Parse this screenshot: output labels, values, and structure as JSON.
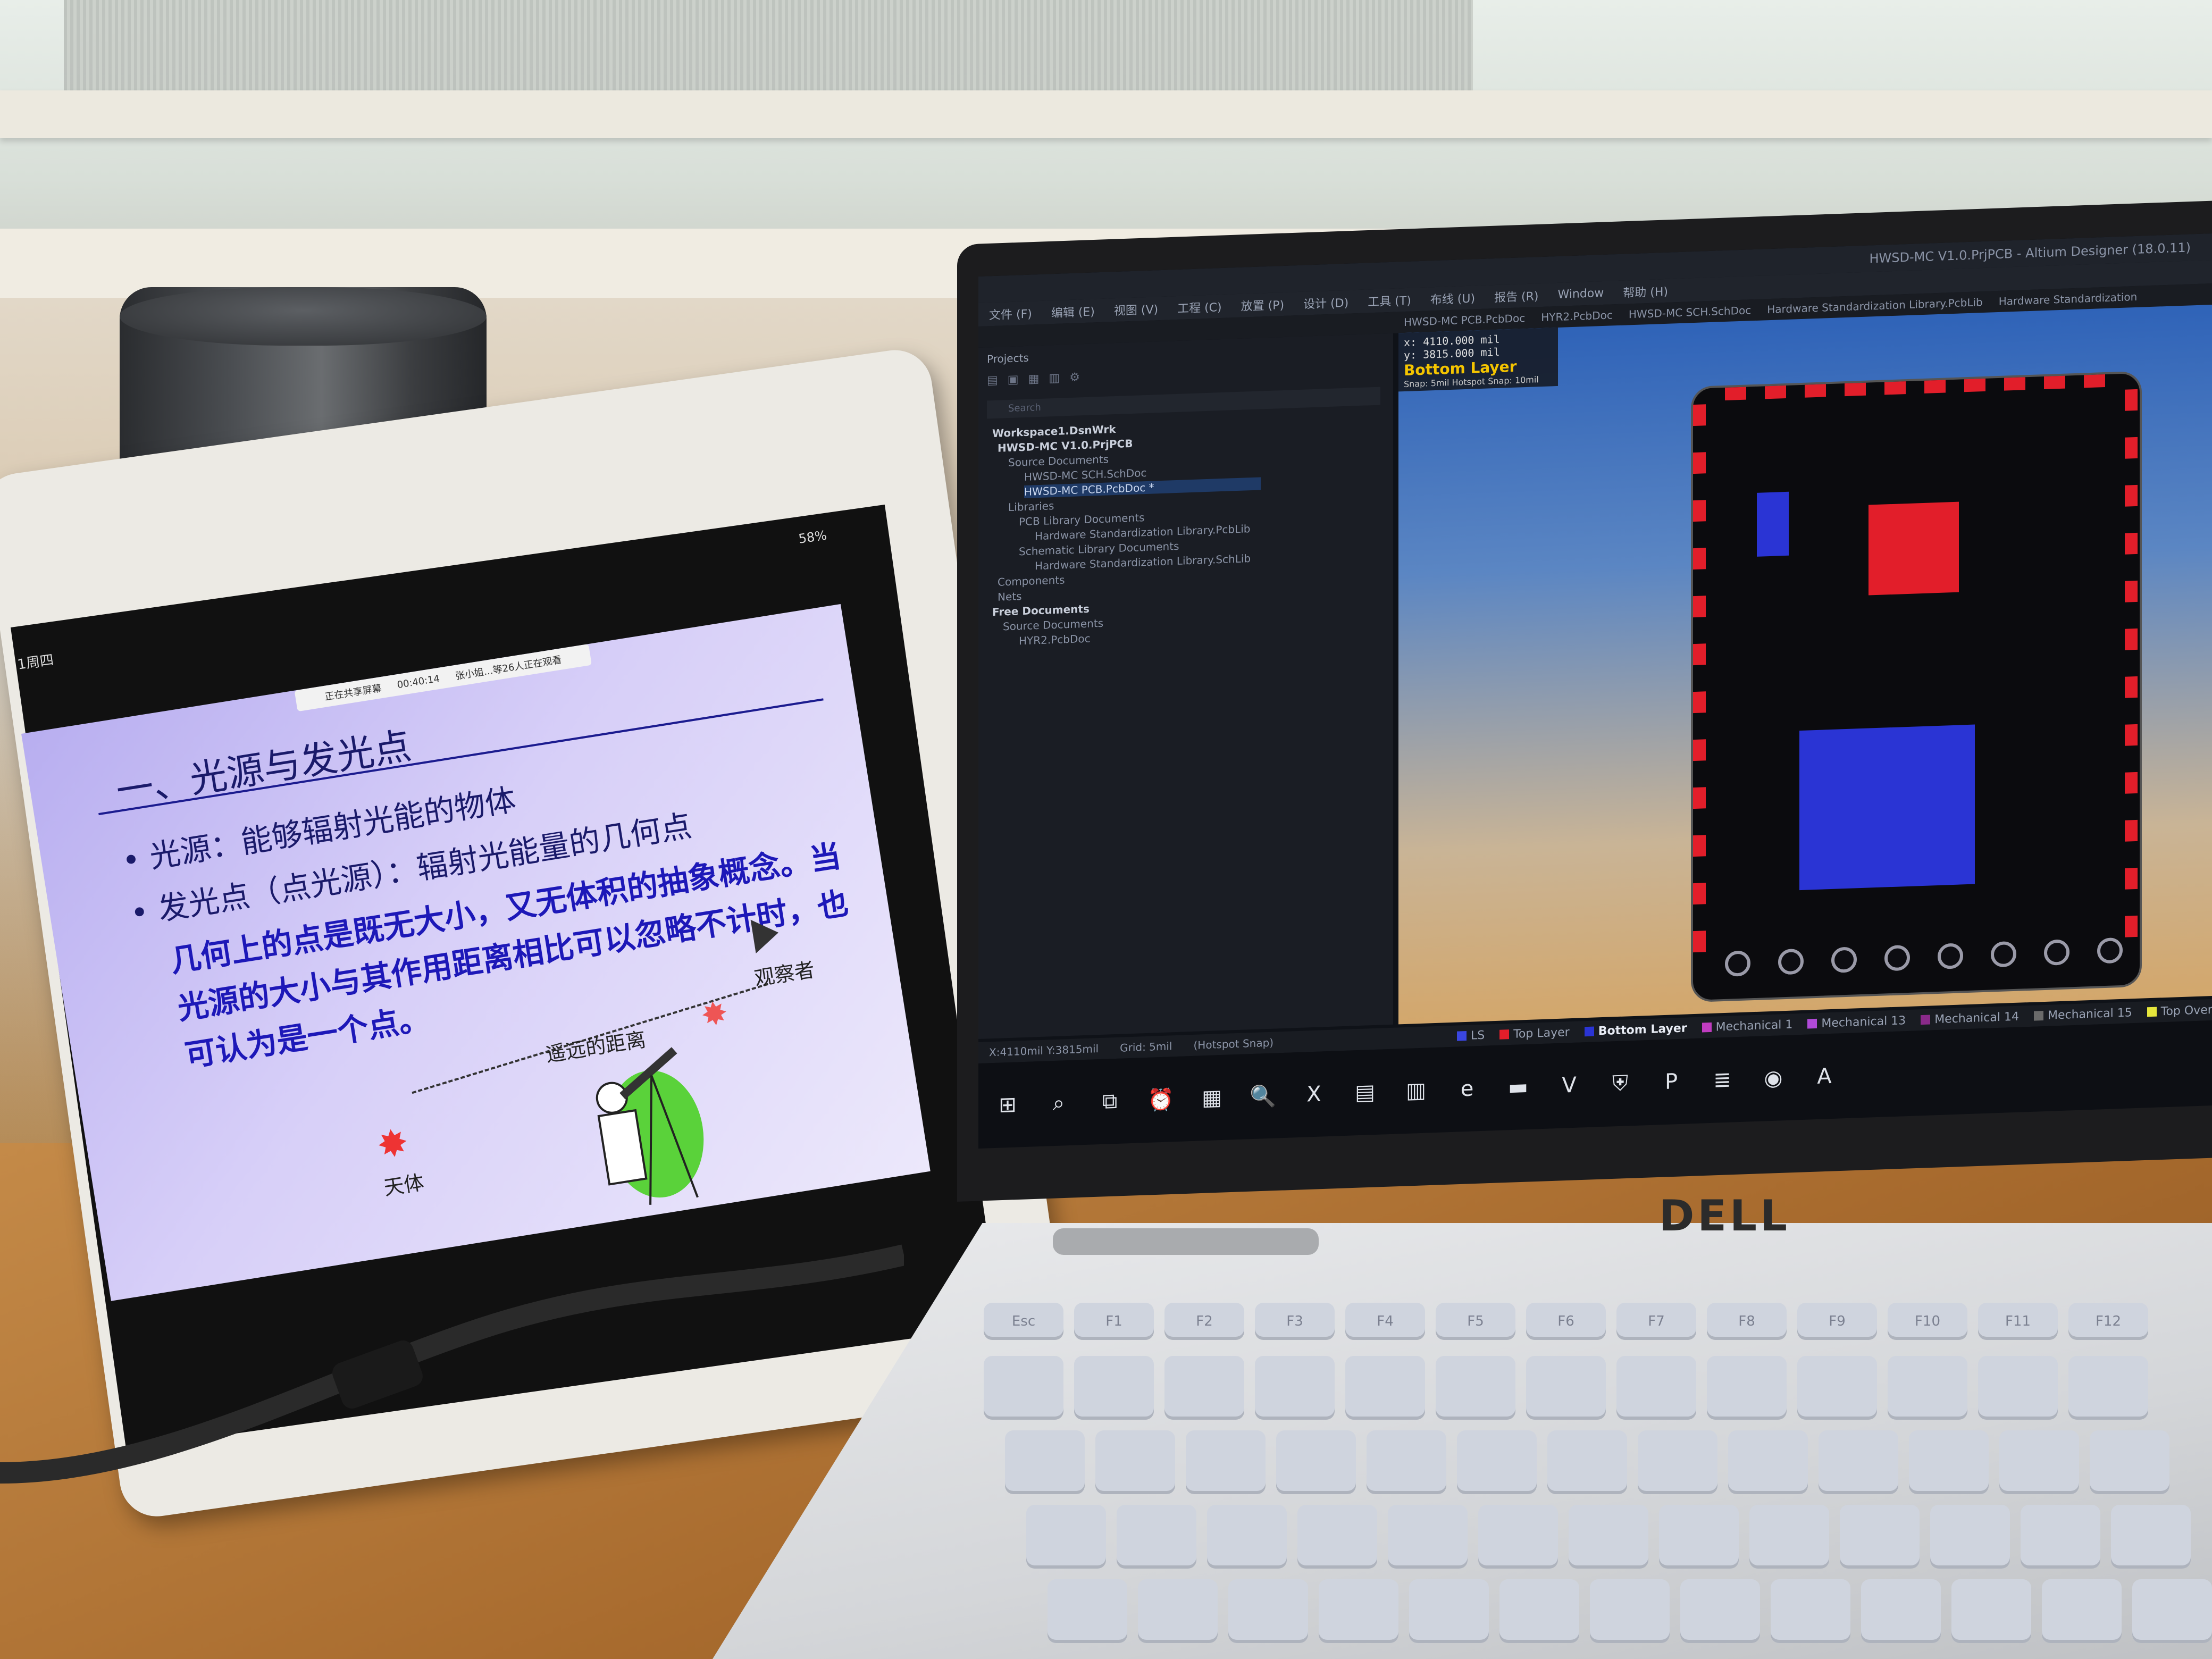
{
  "tablet": {
    "status_left": "1周四",
    "battery": "58%",
    "toolbar": [
      "正在共享屏幕",
      "00:40:14",
      "张小姐...等26人正在观看"
    ],
    "slide": {
      "title": "一、光源与发光点",
      "lines": [
        "• 光源：能够辐射光能的物体",
        "• 发光点（点光源）：辐射光能量的几何点",
        "几何上的点是既无大小，又无体积的抽象概念。当",
        "光源的大小与其作用距离相比可以忽略不计时，也",
        "可认为是一个点。"
      ],
      "label_body": "天体",
      "label_distance": "遥远的距离",
      "label_observer": "观察者"
    }
  },
  "laptop": {
    "brand": "DELL",
    "window_title": "HWSD-MC V1.0.PrjPCB - Altium Designer (18.0.11)",
    "menu": [
      "文件 (F)",
      "编辑 (E)",
      "视图 (V)",
      "工程 (C)",
      "放置 (P)",
      "设计 (D)",
      "工具 (T)",
      "布线 (U)",
      "报告 (R)",
      "Window",
      "帮助 (H)"
    ],
    "doc_tabs": [
      "HWSD-MC PCB.PcbDoc",
      "HYR2.PcbDoc",
      "HWSD-MC SCH.SchDoc",
      "Hardware Standardization Library.PcbLib",
      "Hardware Standardization"
    ],
    "projects": {
      "title": "Projects",
      "search_placeholder": "Search",
      "tree": [
        {
          "label": "Workspace1.DsnWrk",
          "bold": true
        },
        {
          "label": "HWSD-MC V1.0.PrjPCB",
          "bold": true
        },
        {
          "label": "Source Documents"
        },
        {
          "label": "HWSD-MC SCH.SchDoc"
        },
        {
          "label": "HWSD-MC PCB.PcbDoc *",
          "selected": true
        },
        {
          "label": "Libraries"
        },
        {
          "label": "PCB Library Documents"
        },
        {
          "label": "Hardware Standardization Library.PcbLib"
        },
        {
          "label": "Schematic Library Documents"
        },
        {
          "label": "Hardware Standardization Library.SchLib"
        },
        {
          "label": "Components"
        },
        {
          "label": "Nets"
        },
        {
          "label": "Free Documents",
          "bold": true
        },
        {
          "label": "Source Documents"
        },
        {
          "label": "HYR2.PcbDoc"
        }
      ]
    },
    "coords": {
      "x": "x:  4110.000 mil",
      "y": "y:  3815.000 mil",
      "layer": "Bottom Layer",
      "snap": "Snap: 5mil Hotspot Snap: 10mil"
    },
    "status": {
      "position": "X:4110mil Y:3815mil",
      "grid": "Grid: 5mil",
      "hotspot": "(Hotspot Snap)"
    },
    "layers": [
      {
        "label": "LS",
        "color": "#3a46e0"
      },
      {
        "label": "Top Layer",
        "color": "#e21e2a"
      },
      {
        "label": "Bottom Layer",
        "color": "#2a34d4",
        "active": true
      },
      {
        "label": "Mechanical 1",
        "color": "#c03cc0"
      },
      {
        "label": "Mechanical 13",
        "color": "#b04ad8"
      },
      {
        "label": "Mechanical 14",
        "color": "#8a2a8a"
      },
      {
        "label": "Mechanical 15",
        "color": "#6a6a6a"
      },
      {
        "label": "Top Overlay",
        "color": "#e6e63c"
      }
    ],
    "taskbar_icons": [
      "start-icon",
      "search-icon",
      "task-view-icon",
      "clock-icon",
      "calculator-icon",
      "magnifier-icon",
      "excel-icon",
      "notes-icon",
      "file-icon",
      "edge-icon",
      "folder-icon",
      "visio-icon",
      "shield-icon",
      "pdf-icon",
      "server-icon",
      "chrome-icon",
      "altium-icon"
    ],
    "keyboard_keys": [
      "Esc",
      "F1",
      "F2",
      "F3",
      "F4",
      "F5",
      "F6",
      "F7",
      "F8",
      "F9",
      "F10",
      "F11",
      "F12"
    ]
  }
}
